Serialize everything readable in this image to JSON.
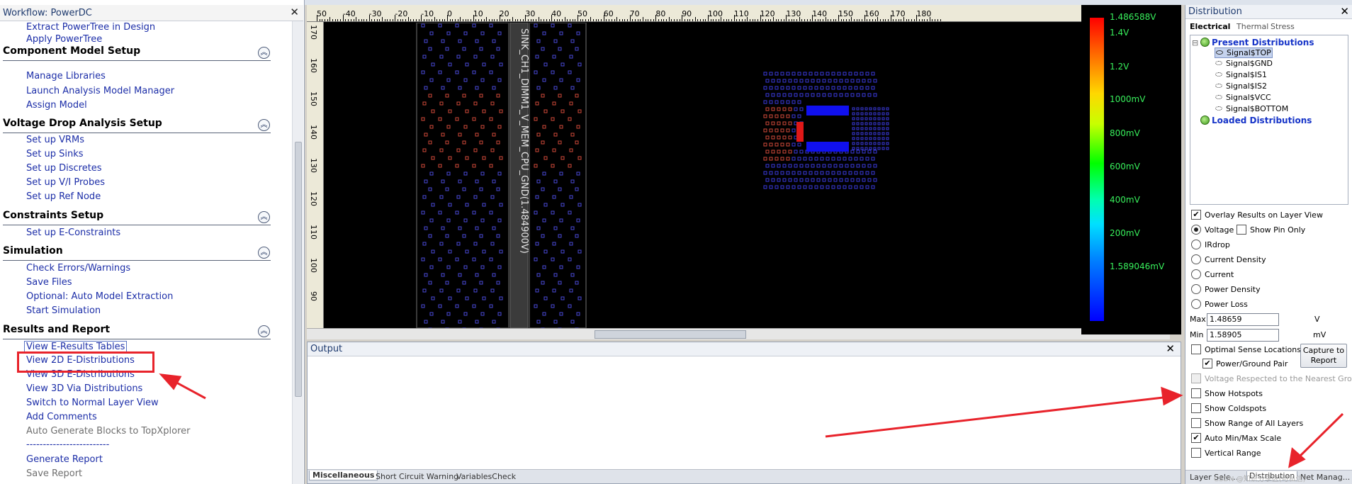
{
  "workflow": {
    "title": "Workflow: PowerDC",
    "close": "✕",
    "top_links": [
      "Extract PowerTree in Design",
      "Apply PowerTree"
    ],
    "sections": [
      {
        "title": "Component Model Setup",
        "items": [
          "Manage Libraries",
          "Launch Analysis Model Manager",
          "Assign Model"
        ]
      },
      {
        "title": "Voltage Drop Analysis Setup",
        "items": [
          "Set up VRMs",
          "Set up Sinks",
          "Set up Discretes",
          "Set up V/I Probes",
          "Set up Ref Node"
        ]
      },
      {
        "title": "Constraints Setup",
        "items": [
          "Set up E-Constraints"
        ]
      },
      {
        "title": "Simulation",
        "items": [
          "Check Errors/Warnings",
          "Save Files",
          "Optional: Auto Model Extraction",
          "Start Simulation"
        ]
      },
      {
        "title": "Results and Report",
        "items": [
          "View E-Results Tables",
          "View 2D E-Distributions",
          "View 3D E-Distributions",
          "View 3D Via Distributions",
          "Switch to Normal Layer View",
          "Add Comments",
          "Auto Generate Blocks to TopXplorer",
          "-------------------------",
          "Generate Report",
          "Save Report"
        ]
      }
    ]
  },
  "ruler": {
    "h_ticks": [
      "50",
      "-40",
      "-30",
      "-20",
      "-10",
      "0",
      "10",
      "20",
      "30",
      "40",
      "50",
      "60",
      "70",
      "80",
      "90",
      "100",
      "110",
      "120",
      "130",
      "140",
      "150",
      "160",
      "170",
      "180"
    ],
    "v_ticks": [
      "170",
      "160",
      "150",
      "140",
      "130",
      "120",
      "110",
      "100",
      "90"
    ]
  },
  "board": {
    "net_label": "SINK_CH1_DIMM1_V_MEM_CPU_GND(1.484900V)"
  },
  "legend": {
    "labels": [
      "1.486588V",
      "1.4V",
      "1.2V",
      "1000mV",
      "800mV",
      "600mV",
      "400mV",
      "200mV",
      "1.589046mV"
    ]
  },
  "output": {
    "title": "Output",
    "close": "✕",
    "tabs": [
      "Miscellaneous",
      "Short Circuit Warning",
      "VariablesCheck"
    ]
  },
  "distribution": {
    "title": "Distribution",
    "close": "✕",
    "tabs": [
      "Electrical",
      "Thermal",
      "Stress"
    ],
    "present_label": "Present Distributions",
    "layers": [
      "Signal$TOP",
      "Signal$GND",
      "Signal$IS1",
      "Signal$IS2",
      "Signal$VCC",
      "Signal$BOTTOM"
    ],
    "loaded_label": "Loaded Distributions",
    "overlay_label": "Overlay Results on Layer View",
    "voltage_label": "Voltage",
    "show_pin_only": "Show Pin Only",
    "radio_options": [
      "IRdrop",
      "Current Density",
      "Current",
      "Power Density",
      "Power Loss"
    ],
    "max_label": "Max",
    "max_value": "1.48659",
    "max_unit": "V",
    "min_label": "Min",
    "min_value": "1.58905",
    "min_unit": "mV",
    "optimal_sense": "Optimal Sense Locations",
    "power_ground_pair": "Power/Ground Pair",
    "capture_line1": "Capture to",
    "capture_line2": "Report",
    "voltage_respected": "Voltage Respected to the Nearest Ground P",
    "show_hotspots": "Show Hotspots",
    "show_coldspots": "Show Coldspots",
    "show_range": "Show Range of All Layers",
    "auto_minmax": "Auto Min/Max Scale",
    "vertical_range": "Vertical Range",
    "bottom_tabs": [
      "Layer Sele...",
      "Distribution",
      "Net Manag..."
    ],
    "watermark": "CSDN @知识分享区(可私信)"
  },
  "colors": {
    "annotation_red": "#e8232b",
    "link_blue": "#1c2ea8",
    "legend_text": "#38f05c"
  }
}
